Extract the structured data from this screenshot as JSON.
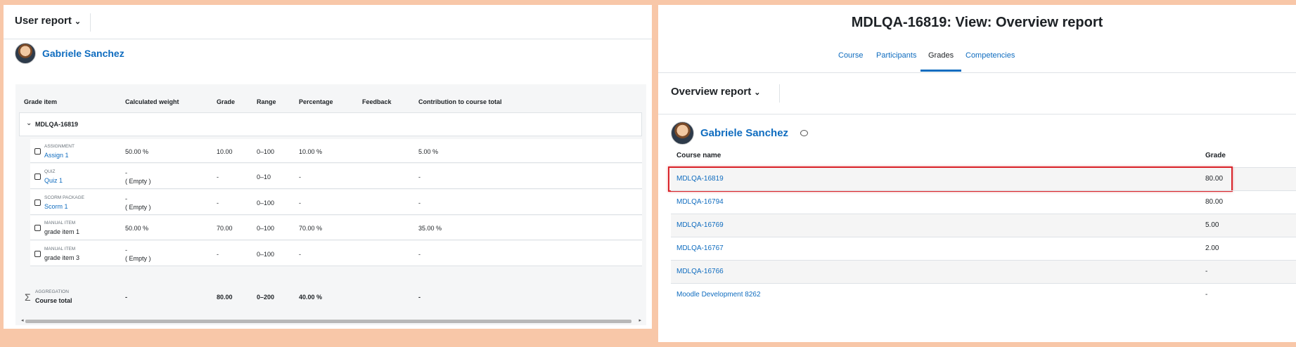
{
  "left": {
    "header_title": "User report",
    "user_name": "Gabriele Sanchez",
    "columns": [
      "Grade item",
      "Calculated weight",
      "Grade",
      "Range",
      "Percentage",
      "Feedback",
      "Contribution to course total"
    ],
    "category": "MDLQA-16819",
    "items": [
      {
        "type": "ASSIGNMENT",
        "name": "Assign 1",
        "link": true,
        "icon": "assignment-icon",
        "weight": "50.00 %",
        "weight2": "",
        "grade": "10.00",
        "range": "0–100",
        "percentage": "10.00 %",
        "contribution": "5.00 %"
      },
      {
        "type": "QUIZ",
        "name": "Quiz 1",
        "link": true,
        "icon": "quiz-icon",
        "weight": "-",
        "weight2": "( Empty )",
        "grade": "-",
        "range": "0–10",
        "percentage": "-",
        "contribution": "-"
      },
      {
        "type": "SCORM PACKAGE",
        "name": "Scorm 1",
        "link": true,
        "icon": "scorm-icon",
        "weight": "-",
        "weight2": "( Empty )",
        "grade": "-",
        "range": "0–100",
        "percentage": "-",
        "contribution": "-"
      },
      {
        "type": "MANUAL ITEM",
        "name": "grade item 1",
        "link": false,
        "icon": "manual-item-icon",
        "weight": "50.00 %",
        "weight2": "",
        "grade": "70.00",
        "range": "0–100",
        "percentage": "70.00 %",
        "contribution": "35.00 %"
      },
      {
        "type": "MANUAL ITEM",
        "name": "grade item 3",
        "link": false,
        "icon": "manual-item-icon",
        "weight": "-",
        "weight2": "( Empty )",
        "grade": "-",
        "range": "0–100",
        "percentage": "-",
        "contribution": "-"
      }
    ],
    "total": {
      "type": "AGGREGATION",
      "name": "Course total",
      "weight": "-",
      "grade": "80.00",
      "range": "0–200",
      "percentage": "40.00 %",
      "contribution": "-"
    }
  },
  "right": {
    "page_title": "MDLQA-16819: View: Overview report",
    "tabs": [
      "Course",
      "Participants",
      "Grades",
      "Competencies"
    ],
    "subheader_title": "Overview report",
    "user_name": "Gabriele Sanchez",
    "columns": [
      "Course name",
      "Grade"
    ],
    "rows": [
      {
        "course": "MDLQA-16819",
        "grade": "80.00"
      },
      {
        "course": "MDLQA-16794",
        "grade": "80.00"
      },
      {
        "course": "MDLQA-16769",
        "grade": "5.00"
      },
      {
        "course": "MDLQA-16767",
        "grade": "2.00"
      },
      {
        "course": "MDLQA-16766",
        "grade": "-"
      },
      {
        "course": "Moodle Development 8262",
        "grade": "-"
      }
    ]
  }
}
